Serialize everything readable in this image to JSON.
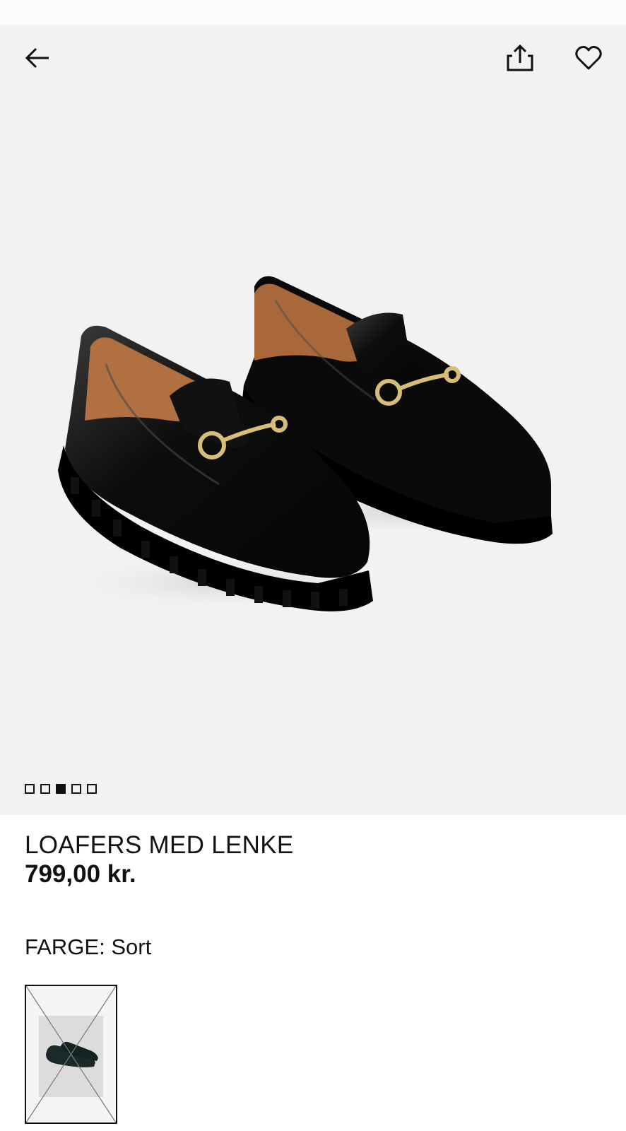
{
  "product": {
    "name": "LOAFERS MED LENKE",
    "price": "799,00 kr."
  },
  "color": {
    "label": "FARGE:",
    "value": "Sort",
    "swatches": [
      {
        "name": "Sort",
        "selected": true,
        "available": false
      }
    ]
  },
  "gallery": {
    "image_count": 5,
    "active_index": 3
  },
  "icons": {
    "back": "arrow-left-icon",
    "share": "share-icon",
    "favorite": "heart-icon"
  }
}
